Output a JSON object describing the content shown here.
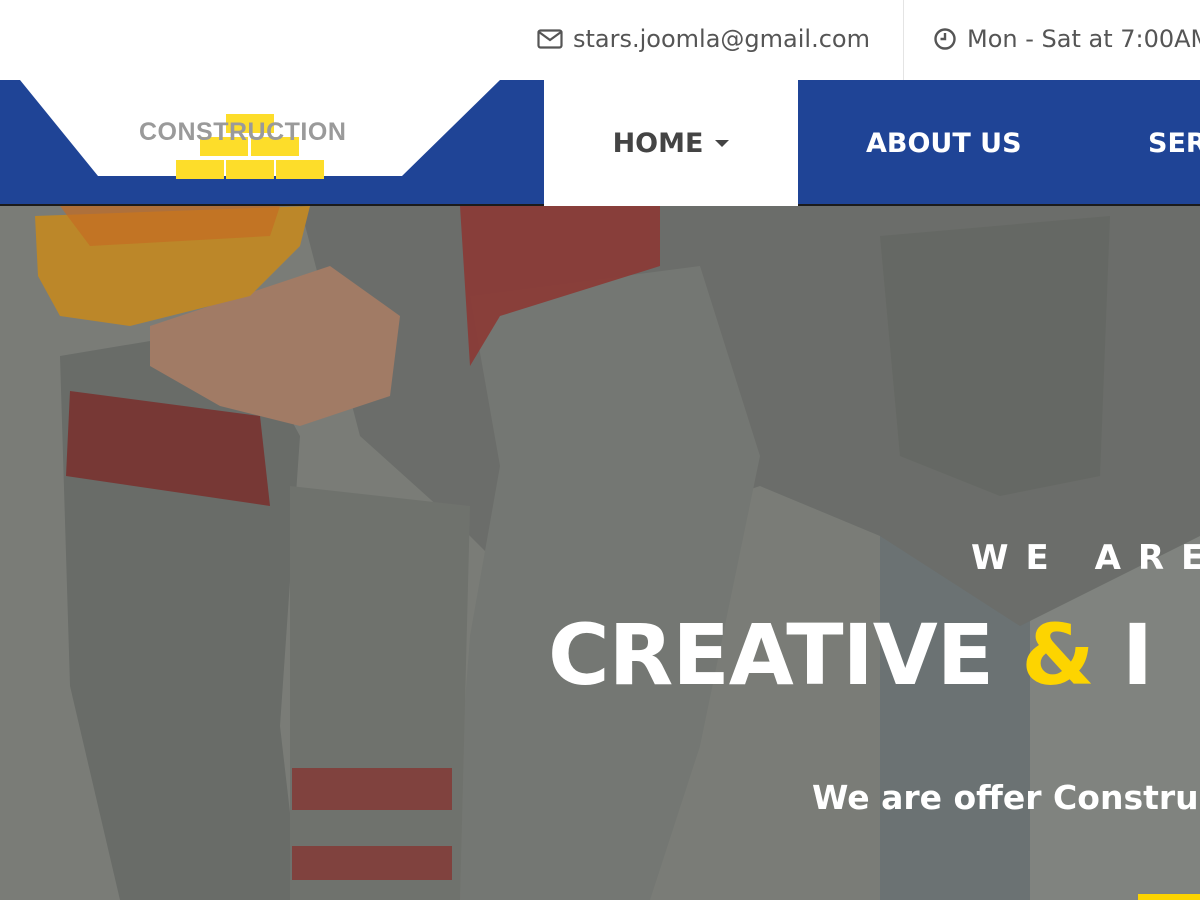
{
  "topbar": {
    "email": "stars.joomla@gmail.com",
    "email_icon": "envelope-icon",
    "hours": "Mon - Sat at 7:00AM",
    "hours_icon": "clock-icon"
  },
  "brand": {
    "logo_text": "CONSTRUCTION",
    "logo_icon": "brick-stack-icon",
    "colors": {
      "primary": "#1f4496",
      "accent": "#fdd400"
    }
  },
  "nav": {
    "items": [
      {
        "label": "HOME",
        "active": true,
        "has_dropdown": true
      },
      {
        "label": "ABOUT US",
        "active": false
      },
      {
        "label": "SERV",
        "active": false
      }
    ]
  },
  "hero": {
    "pretitle": "WE ARE",
    "title_part1": "CREATIVE",
    "title_amp": "&",
    "title_part2": "I",
    "subtitle": "We are offer Construc"
  }
}
